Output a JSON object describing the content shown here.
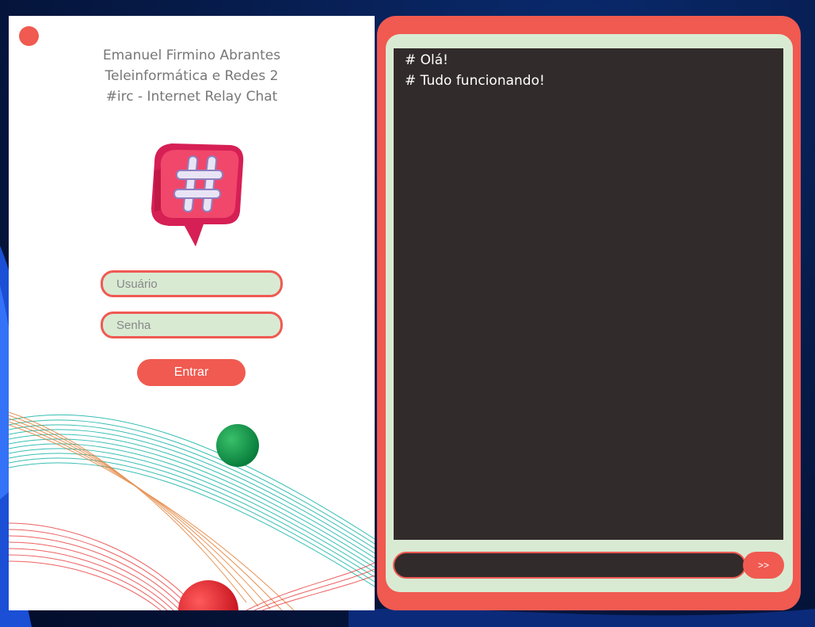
{
  "login": {
    "header": {
      "name": "Emanuel Firmino Abrantes",
      "course": "Teleinformática e Redes 2",
      "subtitle": "#irc - Internet Relay Chat"
    },
    "logo_icon": "hashtag-chat-bubble-icon",
    "username_placeholder": "Usuário",
    "password_placeholder": "Senha",
    "submit_label": "Entrar"
  },
  "chat": {
    "messages": [
      "# Olá!",
      "# Tudo funcionando!"
    ],
    "message_input_value": "",
    "send_label": ">>"
  },
  "colors": {
    "accent": "#f05a50",
    "chat_background": "#322b2b",
    "input_fill": "#d9ead3",
    "teal": "#14b3a6",
    "green": "#0f9e52"
  }
}
